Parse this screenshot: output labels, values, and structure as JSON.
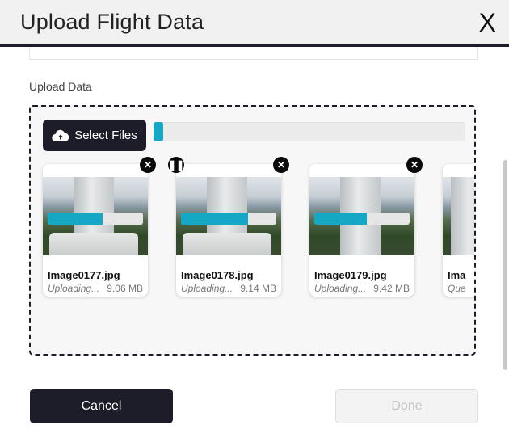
{
  "dialog": {
    "title": "Upload Flight Data",
    "close_label": "X"
  },
  "upload": {
    "section_label": "Upload Data",
    "select_files_label": "Select Files",
    "overall_progress_percent": 3,
    "files": [
      {
        "name": "Image0177.jpg",
        "status": "Uploading...",
        "size": "9.06 MB",
        "progress_percent": 58,
        "controls": [
          "remove"
        ]
      },
      {
        "name": "Image0178.jpg",
        "status": "Uploading...",
        "size": "9.14 MB",
        "progress_percent": 70,
        "controls": [
          "pause",
          "remove"
        ]
      },
      {
        "name": "Image0179.jpg",
        "status": "Uploading...",
        "size": "9.42 MB",
        "progress_percent": 55,
        "controls": [
          "remove"
        ]
      },
      {
        "name": "Ima",
        "status": "Que",
        "size": "",
        "progress_percent": 0,
        "controls": []
      }
    ]
  },
  "footer": {
    "cancel_label": "Cancel",
    "done_label": "Done"
  },
  "colors": {
    "accent": "#14a8c4",
    "dark": "#1c1d28"
  }
}
